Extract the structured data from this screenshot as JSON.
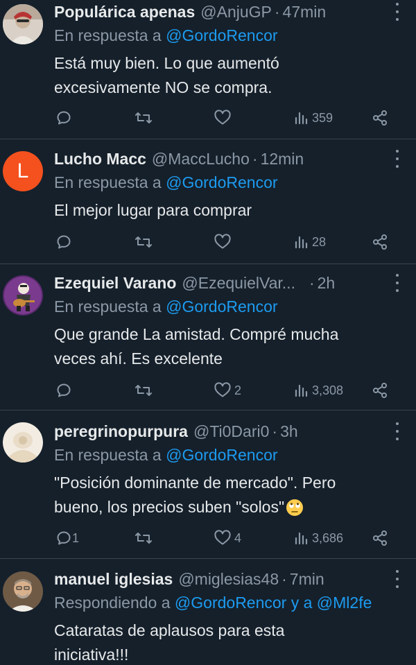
{
  "tweets": [
    {
      "name": "Populárica apenas",
      "handle": "@AnjuGP",
      "dot": "·",
      "time": "47min",
      "reply_prefix": "En respuesta a ",
      "reply_to": "@GordoRencor",
      "text_lines": [
        "Está muy bien. Lo que aumentó",
        "excesivamente NO se compra."
      ],
      "replies": "",
      "likes": "",
      "views": "359"
    },
    {
      "name": "Lucho Macc",
      "handle": "@MaccLucho",
      "dot": "·",
      "time": "12min",
      "avatar_letter": "L",
      "reply_prefix": "En respuesta a ",
      "reply_to": "@GordoRencor",
      "text_lines": [
        "El mejor lugar para comprar"
      ],
      "replies": "",
      "likes": "",
      "views": "28"
    },
    {
      "name": "Ezequiel Varano",
      "handle": "@EzequielVar...",
      "dot": "·",
      "time": "2h",
      "reply_prefix": "En respuesta a ",
      "reply_to": "@GordoRencor",
      "text_lines": [
        "Que grande La amistad. Compré mucha",
        "veces ahí. Es excelente"
      ],
      "replies": "",
      "likes": "2",
      "views": "3,308"
    },
    {
      "name": "peregrinopurpura",
      "handle": "@Ti0Dari0",
      "dot": "·",
      "time": "3h",
      "reply_prefix": "En respuesta a ",
      "reply_to": "@GordoRencor",
      "text_lines": [
        "\"Posición dominante de mercado\". Pero",
        "bueno, los precios suben \"solos\""
      ],
      "replies": "1",
      "likes": "4",
      "views": "3,686"
    },
    {
      "name": "manuel iglesias",
      "handle": "@miglesias48",
      "dot": "·",
      "time": "7min",
      "reply_prefix": "Respondiendo a ",
      "reply_to": "@GordoRencor y a @Ml2fe",
      "text_lines": [
        "Cataratas de aplausos para esta",
        "iniciativa!!!"
      ]
    }
  ],
  "colors": {
    "background": "#15202b",
    "accent": "#1d9bf0",
    "muted": "#8b98a5",
    "divider": "#38444d"
  },
  "icons": [
    "reply-icon",
    "retweet-icon",
    "like-icon",
    "views-icon",
    "share-icon",
    "more-icon",
    "eye-roll-emoji"
  ]
}
